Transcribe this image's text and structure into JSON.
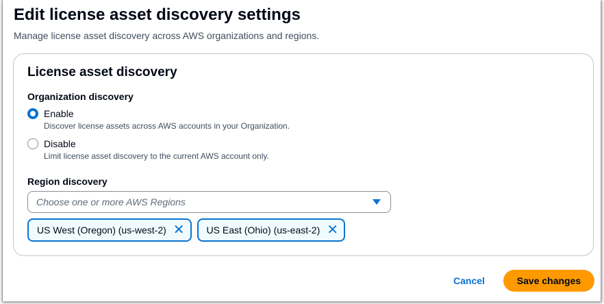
{
  "header": {
    "title": "Edit license asset discovery settings",
    "subtitle": "Manage license asset discovery across AWS organizations and regions."
  },
  "card": {
    "title": "License asset discovery",
    "org_label": "Organization discovery",
    "options": [
      {
        "label": "Enable",
        "desc": "Discover license assets across AWS accounts in your Organization.",
        "selected": true
      },
      {
        "label": "Disable",
        "desc": "Limit license asset discovery to the current AWS account only.",
        "selected": false
      }
    ],
    "region_label": "Region discovery",
    "region_placeholder": "Choose one or more AWS Regions",
    "tokens": [
      "US West (Oregon) (us-west-2)",
      "US East (Ohio) (us-east-2)"
    ],
    "remove_glyph": "✕"
  },
  "footer": {
    "cancel": "Cancel",
    "save": "Save changes"
  },
  "colors": {
    "accent": "#0972d3",
    "primary_button": "#ff9900"
  }
}
